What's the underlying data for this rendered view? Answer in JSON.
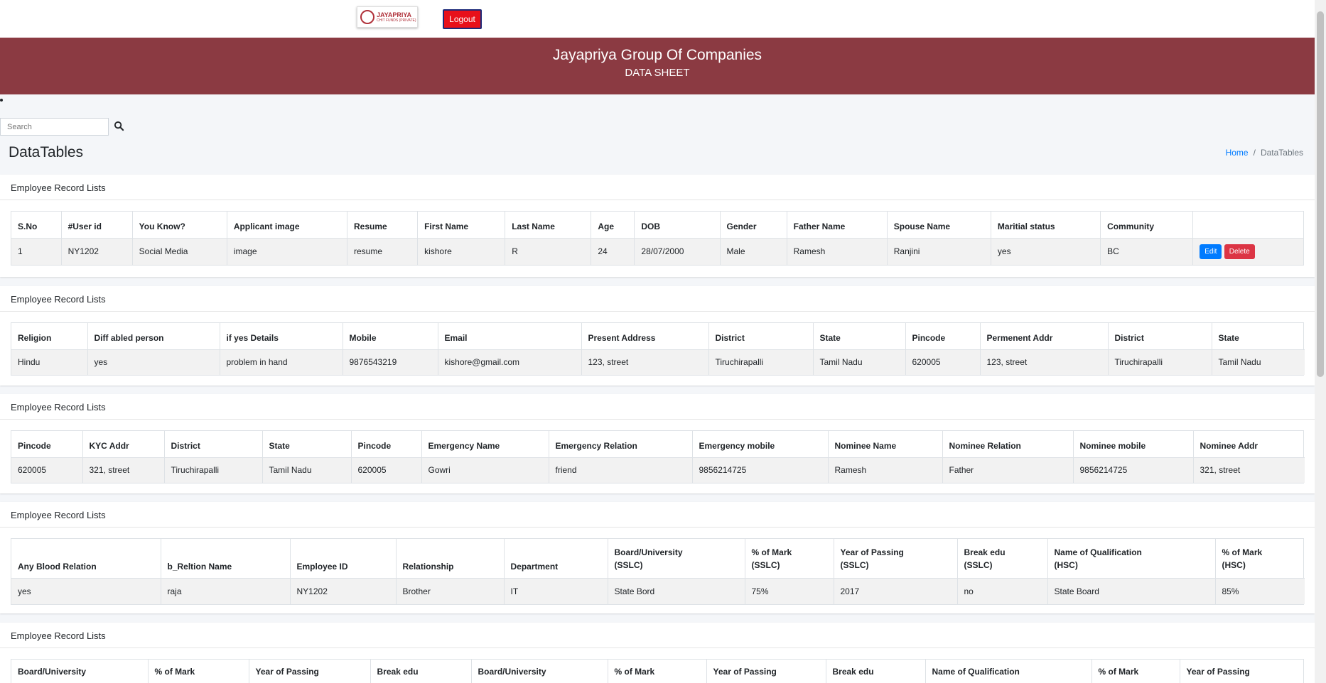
{
  "header": {
    "logo_text": "JAYAPRIYA",
    "logo_sub": "CHIT FUNDS (PRIVATE)",
    "logout_label": "Logout"
  },
  "banner": {
    "title": "Jayapriya Group Of Companies",
    "subtitle": "DATA SHEET"
  },
  "search": {
    "placeholder": "Search",
    "icon": "search-icon"
  },
  "page": {
    "title": "DataTables"
  },
  "breadcrumb": {
    "home": "Home",
    "sep": "/",
    "current": "DataTables"
  },
  "actions": {
    "edit": "Edit",
    "delete": "Delete"
  },
  "cards": [
    {
      "title": "Employee Record Lists",
      "headers": [
        "S.No",
        "#User id",
        "You Know?",
        "Applicant image",
        "Resume",
        "First Name",
        "Last Name",
        "Age",
        "DOB",
        "Gender",
        "Father Name",
        "Spouse Name",
        "Maritial status",
        "Community",
        ""
      ],
      "row": [
        "1",
        "NY1202",
        "Social Media",
        "image",
        "resume",
        "kishore",
        "R",
        "24",
        "28/07/2000",
        "Male",
        "Ramesh",
        "Ranjini",
        "yes",
        "BC",
        ""
      ]
    },
    {
      "title": "Employee Record Lists",
      "headers": [
        "Religion",
        "Diff abled person",
        "if yes Details",
        "Mobile",
        "Email",
        "Present Address",
        "District",
        "State",
        "Pincode",
        "Permenent Addr",
        "District",
        "State"
      ],
      "row": [
        "Hindu",
        "yes",
        "problem in hand",
        "9876543219",
        "kishore@gmail.com",
        "123, street",
        "Tiruchirapalli",
        "Tamil Nadu",
        "620005",
        "123, street",
        "Tiruchirapalli",
        "Tamil Nadu"
      ]
    },
    {
      "title": "Employee Record Lists",
      "headers": [
        "Pincode",
        "KYC Addr",
        "District",
        "State",
        "Pincode",
        "Emergency Name",
        "Emergency Relation",
        "Emergency mobile",
        "Nominee Name",
        "Nominee Relation",
        "Nominee mobile",
        "Nominee Addr"
      ],
      "row": [
        "620005",
        "321, street",
        "Tiruchirapalli",
        "Tamil Nadu",
        "620005",
        "Gowri",
        "friend",
        "9856214725",
        "Ramesh",
        "Father",
        "9856214725",
        "321, street"
      ]
    },
    {
      "title": "Employee Record Lists",
      "headers": [
        "Any Blood Relation",
        "b_Reltion Name",
        "Employee ID",
        "Relationship",
        "Department",
        "Board/University\n(SSLC)",
        "% of Mark\n(SSLC)",
        "Year of Passing\n(SSLC)",
        "Break edu\n(SSLC)",
        "Name of Qualification\n(HSC)",
        "% of Mark\n(HSC)"
      ],
      "row": [
        "yes",
        "raja",
        "NY1202",
        "Brother",
        "IT",
        "State Bord",
        "75%",
        "2017",
        "no",
        "State Board",
        "85%"
      ]
    },
    {
      "title": "Employee Record Lists",
      "headers": [
        "Board/University",
        "% of Mark",
        "Year of Passing",
        "Break edu",
        "Board/University",
        "% of Mark",
        "Year of Passing",
        "Break edu",
        "Name of Qualification",
        "% of Mark",
        "Year of Passing"
      ],
      "row": []
    }
  ]
}
